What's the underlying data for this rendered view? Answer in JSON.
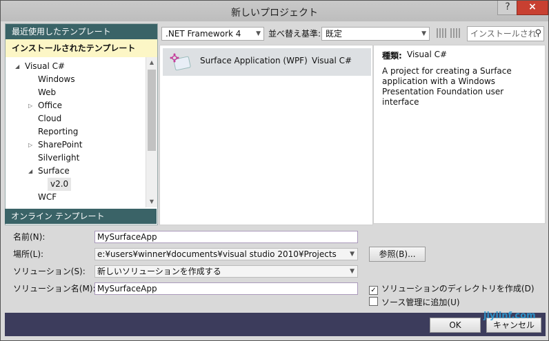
{
  "window": {
    "title": "新しいプロジェクト",
    "help": "?",
    "close": "×"
  },
  "left": {
    "recent_header": "最近使用したテンプレート",
    "installed_header": "インストールされたテンプレート",
    "tree": [
      {
        "label": "Visual C#",
        "arrow": "◢"
      },
      {
        "label": "Windows",
        "arrow": ""
      },
      {
        "label": "Web",
        "arrow": ""
      },
      {
        "label": "Office",
        "arrow": "▷"
      },
      {
        "label": "Cloud",
        "arrow": ""
      },
      {
        "label": "Reporting",
        "arrow": ""
      },
      {
        "label": "SharePoint",
        "arrow": "▷"
      },
      {
        "label": "Silverlight",
        "arrow": ""
      },
      {
        "label": "Surface",
        "arrow": "◢"
      },
      {
        "label": "v2.0",
        "arrow": ""
      },
      {
        "label": "WCF",
        "arrow": ""
      }
    ],
    "online_header": "オンライン テンプレート"
  },
  "toolbar": {
    "framework": ".NET Framework 4",
    "sort_label": "並べ替え基準:",
    "sort_value": "既定",
    "search_placeholder": "インストールされた",
    "search_icon": "magnifier-icon"
  },
  "templates": [
    {
      "name": "Surface Application (WPF)",
      "language": "Visual C#"
    }
  ],
  "description": {
    "type_label": "種類:",
    "type_value": "Visual C#",
    "text": "A project for creating a Surface application with a Windows Presentation Foundation user interface"
  },
  "form": {
    "name_label": "名前(N):",
    "name_value": "MySurfaceApp",
    "location_label": "場所(L):",
    "location_value": "e:¥users¥winner¥documents¥visual studio 2010¥Projects",
    "browse_label": "参照(B)...",
    "solution_label": "ソリューション(S):",
    "solution_value": "新しいソリューションを作成する",
    "solution_name_label": "ソリューション名(M):",
    "solution_name_value": "MySurfaceApp",
    "create_dir_label": "ソリューションのディレクトリを作成(D)",
    "create_dir_checked": true,
    "source_control_label": "ソース管理に追加(U)",
    "source_control_checked": false
  },
  "footer": {
    "ok_label": "OK",
    "cancel_label": "キャンセル"
  },
  "watermark": "jiyiinf.com"
}
